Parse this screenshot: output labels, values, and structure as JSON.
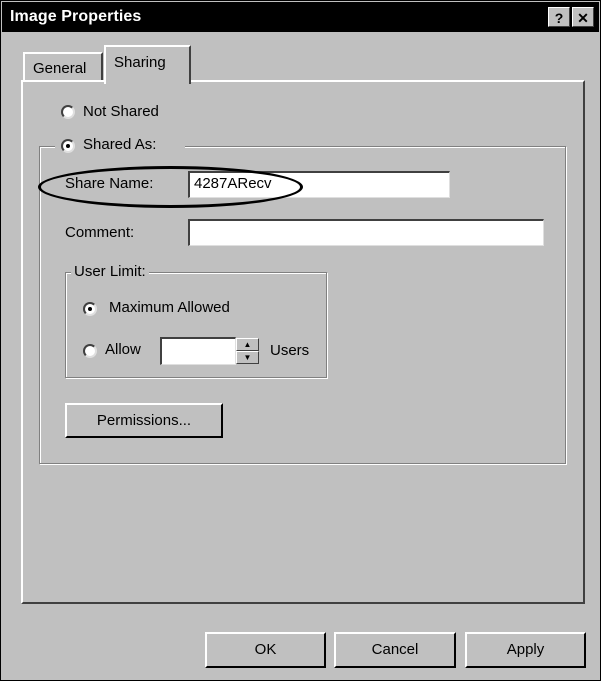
{
  "window": {
    "title": "Image Properties",
    "help_label": "?",
    "close_label": "✕"
  },
  "tabs": [
    {
      "label": "General"
    },
    {
      "label": "Sharing"
    }
  ],
  "sharing": {
    "not_shared_label": "Not Shared",
    "shared_as_label": "Shared As:",
    "share_name_label": "Share Name:",
    "share_name_value": "4287ARecv",
    "comment_label": "Comment:",
    "comment_value": "",
    "user_limit_legend": "User Limit:",
    "maximum_allowed_label": "Maximum Allowed",
    "allow_label": "Allow",
    "allow_value": "",
    "users_label": "Users",
    "permissions_label": "Permissions..."
  },
  "footer": {
    "ok_label": "OK",
    "cancel_label": "Cancel",
    "apply_label": "Apply"
  }
}
